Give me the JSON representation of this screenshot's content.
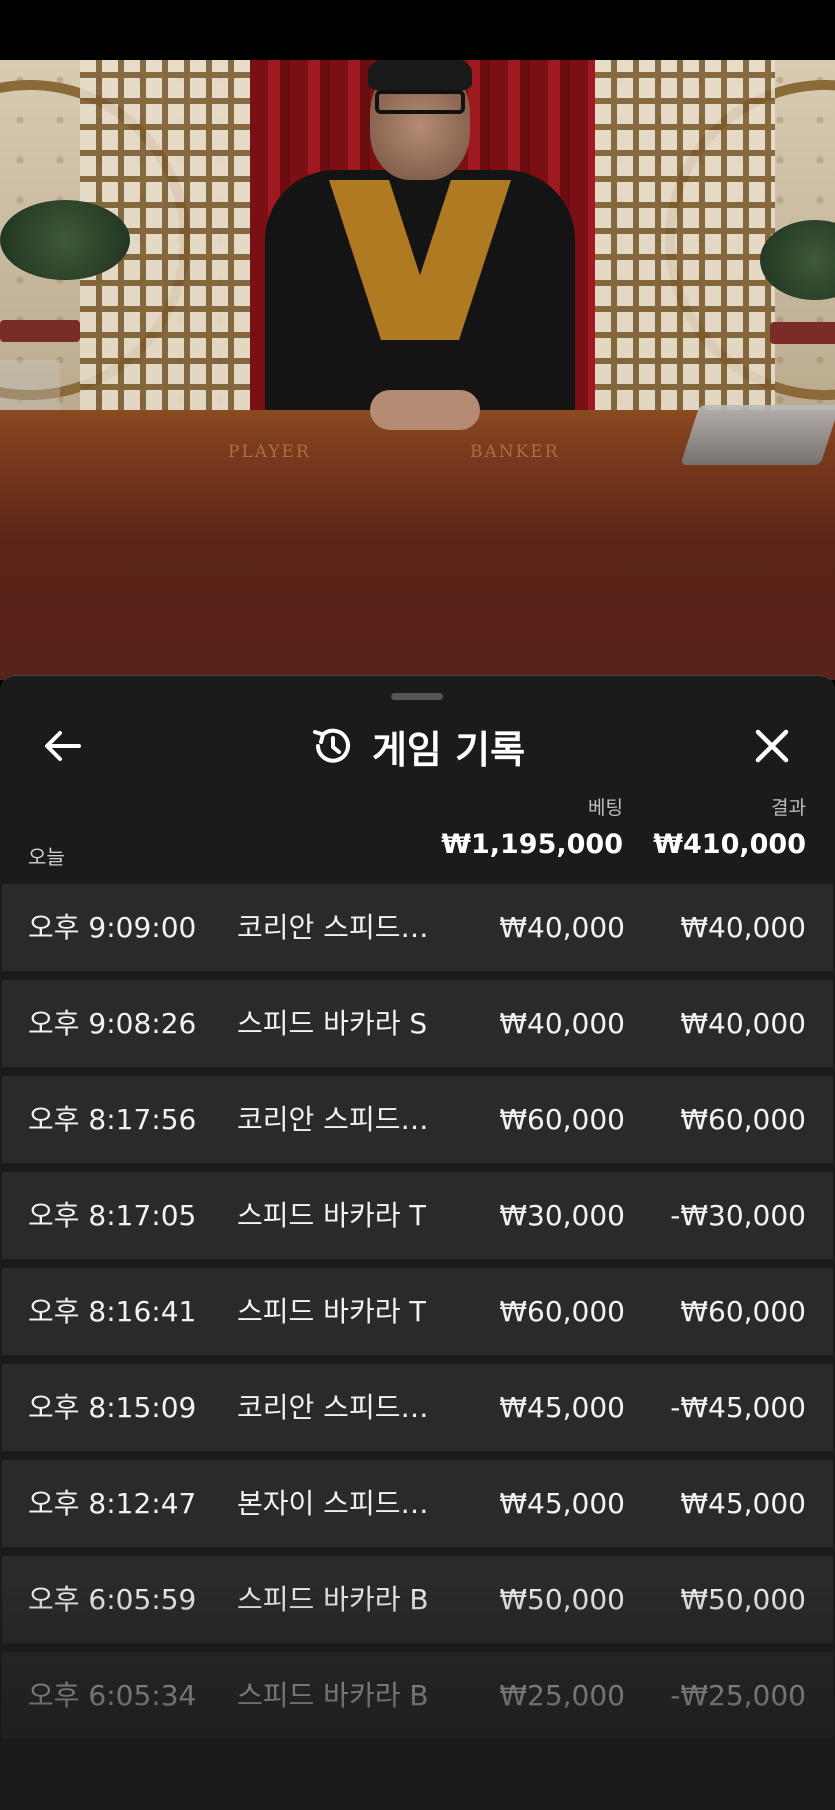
{
  "video": {
    "table_labels": {
      "player": "PLAYER",
      "banker": "BANKER"
    }
  },
  "header": {
    "title": "게임 기록",
    "back_icon": "arrow-left-icon",
    "history_icon": "history-icon",
    "close_icon": "close-icon"
  },
  "summary": {
    "today_label": "오늘",
    "bet_label": "베팅",
    "result_label": "결과",
    "bet_total": "₩1,195,000",
    "result_total": "₩410,000"
  },
  "rows": [
    {
      "time": "오후 9:09:00",
      "game": "코리안 스피드 바카라",
      "bet": "₩40,000",
      "result": "₩40,000"
    },
    {
      "time": "오후 9:08:26",
      "game": "스피드 바카라 S",
      "bet": "₩40,000",
      "result": "₩40,000"
    },
    {
      "time": "오후 8:17:56",
      "game": "코리안 스피드 바카라",
      "bet": "₩60,000",
      "result": "₩60,000"
    },
    {
      "time": "오후 8:17:05",
      "game": "스피드 바카라 T",
      "bet": "₩30,000",
      "result": "-₩30,000"
    },
    {
      "time": "오후 8:16:41",
      "game": "스피드 바카라 T",
      "bet": "₩60,000",
      "result": "₩60,000"
    },
    {
      "time": "오후 8:15:09",
      "game": "코리안 스피드 바카라",
      "bet": "₩45,000",
      "result": "-₩45,000"
    },
    {
      "time": "오후 8:12:47",
      "game": "본자이 스피드 바카라",
      "bet": "₩45,000",
      "result": "₩45,000"
    },
    {
      "time": "오후 6:05:59",
      "game": "스피드 바카라 B",
      "bet": "₩50,000",
      "result": "₩50,000"
    },
    {
      "time": "오후 6:05:34",
      "game": "스피드 바카라 B",
      "bet": "₩25,000",
      "result": "-₩25,000"
    }
  ]
}
